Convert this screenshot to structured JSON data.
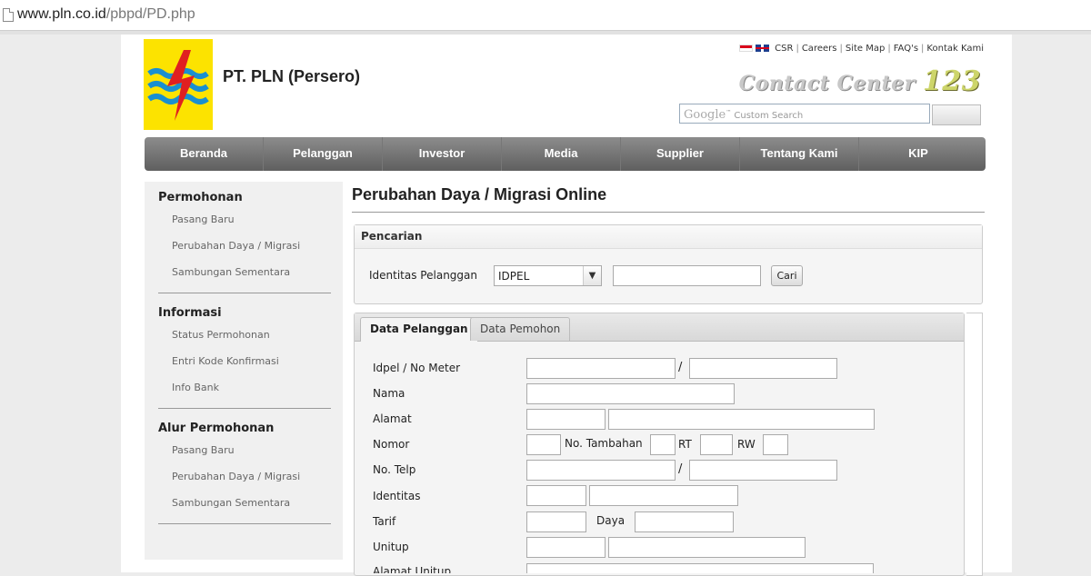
{
  "browser": {
    "url_host": "www.pln.co.id",
    "url_path": "/pbpd/PD.php"
  },
  "header": {
    "company": "PT. PLN (Persero)",
    "top_links": [
      "CSR",
      "Careers",
      "Site Map",
      "FAQ's",
      "Kontak Kami"
    ],
    "contact_center_text": "Contact Center",
    "contact_center_number": "123",
    "search_brand": "Google",
    "search_placeholder": "Custom Search"
  },
  "nav": [
    "Beranda",
    "Pelanggan",
    "Investor",
    "Media",
    "Supplier",
    "Tentang Kami",
    "KIP"
  ],
  "sidebar": {
    "permohonan": {
      "title": "Permohonan",
      "items": [
        "Pasang Baru",
        "Perubahan Daya / Migrasi",
        "Sambungan Sementara"
      ]
    },
    "informasi": {
      "title": "Informasi",
      "items": [
        "Status Permohonan",
        "Entri Kode Konfirmasi",
        "Info Bank"
      ]
    },
    "alur": {
      "title": "Alur Permohonan",
      "items": [
        "Pasang Baru",
        "Perubahan Daya / Migrasi",
        "Sambungan Sementara"
      ]
    }
  },
  "main": {
    "title": "Perubahan Daya / Migrasi Online",
    "pencarian": {
      "heading": "Pencarian",
      "label": "Identitas Pelanggan",
      "select_value": "IDPEL",
      "button": "Cari"
    },
    "tabs": [
      "Data Pelanggan",
      "Data Pemohon"
    ],
    "form": {
      "idpel": "Idpel / No Meter",
      "nama": "Nama",
      "alamat": "Alamat",
      "nomor": "Nomor",
      "no_tambahan": "No. Tambahan",
      "rt": "RT",
      "rw": "RW",
      "no_telp": "No. Telp",
      "identitas": "Identitas",
      "tarif": "Tarif",
      "daya": "Daya",
      "unitup": "Unitup",
      "alamat_unitup": "Alamat Unitup",
      "slash": "/"
    }
  }
}
